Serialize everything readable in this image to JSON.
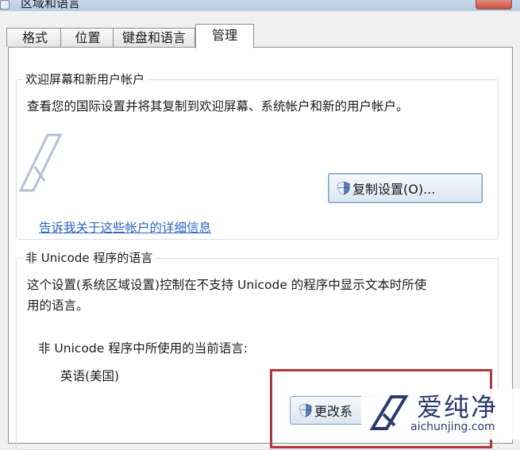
{
  "window": {
    "title": "区域和语言"
  },
  "tabs": [
    {
      "label": "格式"
    },
    {
      "label": "位置"
    },
    {
      "label": "键盘和语言"
    },
    {
      "label": "管理"
    }
  ],
  "welcome_group": {
    "legend": "欢迎屏幕和新用户帐户",
    "description": "查看您的国际设置并将其复制到欢迎屏幕、系统帐户和新的用户帐户。",
    "copy_button": "复制设置(O)...",
    "link": "告诉我关于这些帐户的详细信息"
  },
  "nonunicode_group": {
    "legend": "非 Unicode 程序的语言",
    "description_line1": "这个设置(系统区域设置)控制在不支持 Unicode 的程序中显示文本时所使",
    "description_line2": "用的语言。",
    "current_label": "非 Unicode 程序中所使用的当前语言:",
    "current_value": "英语(美国)",
    "change_button": "更改系"
  },
  "watermark": {
    "brand": "爱纯净",
    "url": "aichunjing.com"
  },
  "colors": {
    "link": "#2a63c4",
    "highlight_box": "#b3343a",
    "watermark": "#2b3a6b"
  }
}
